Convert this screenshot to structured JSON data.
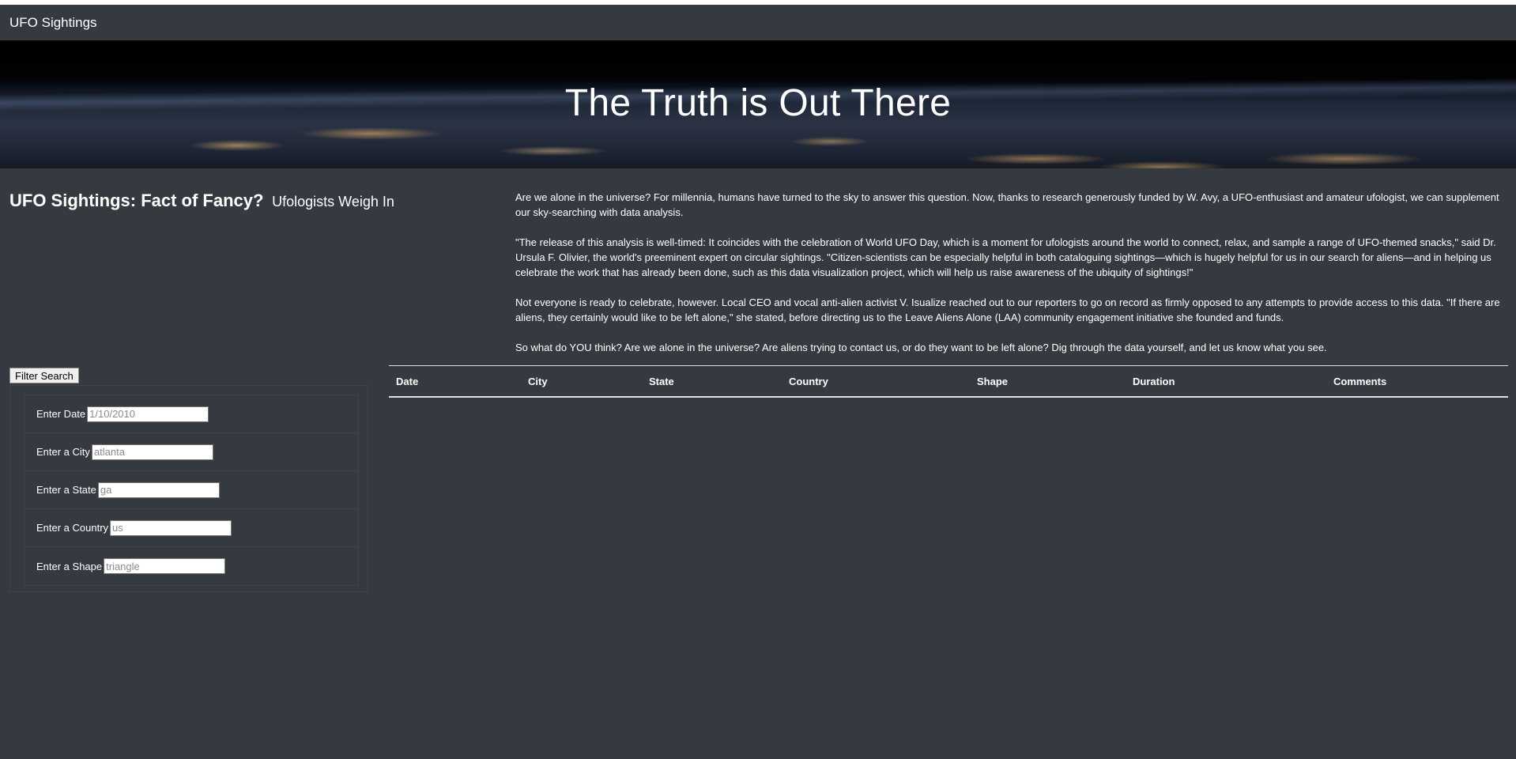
{
  "navbar": {
    "brand": "UFO Sightings"
  },
  "hero": {
    "title": "The Truth is Out There"
  },
  "headline": {
    "main": "UFO Sightings: Fact of Fancy?",
    "sub": "Ufologists Weigh In"
  },
  "article": {
    "paragraphs": [
      "Are we alone in the universe? For millennia, humans have turned to the sky to answer this question. Now, thanks to research generously funded by W. Avy, a UFO-enthusiast and amateur ufologist, we can supplement our sky-searching with data analysis.",
      "\"The release of this analysis is well-timed: It coincides with the celebration of World UFO Day, which is a moment for ufologists around the world to connect, relax, and sample a range of UFO-themed snacks,\" said Dr. Ursula F. Olivier, the world's preeminent expert on circular sightings. \"Citizen-scientists can be especially helpful in both cataloguing sightings—which is hugely helpful for us in our search for aliens—and in helping us celebrate the work that has already been done, such as this data visualization project, which will help us raise awareness of the ubiquity of sightings!\"",
      "Not everyone is ready to celebrate, however. Local CEO and vocal anti-alien activist V. Isualize reached out to our reporters to go on record as firmly opposed to any attempts to provide access to this data. \"If there are aliens, they certainly would like to be left alone,\" she stated, before directing us to the Leave Aliens Alone (LAA) community engagement initiative she founded and funds.",
      "So what do YOU think? Are we alone in the universe? Are aliens trying to contact us, or do they want to be left alone? Dig through the data yourself, and let us know what you see."
    ]
  },
  "filters": {
    "button_label": "Filter Search",
    "items": [
      {
        "label": "Enter Date",
        "placeholder": "1/10/2010",
        "value": ""
      },
      {
        "label": "Enter a City",
        "placeholder": "atlanta",
        "value": ""
      },
      {
        "label": "Enter a State",
        "placeholder": "ga",
        "value": ""
      },
      {
        "label": "Enter a Country",
        "placeholder": "us",
        "value": ""
      },
      {
        "label": "Enter a Shape",
        "placeholder": "triangle",
        "value": ""
      }
    ]
  },
  "table": {
    "columns": [
      "Date",
      "City",
      "State",
      "Country",
      "Shape",
      "Duration",
      "Comments"
    ],
    "rows": []
  }
}
